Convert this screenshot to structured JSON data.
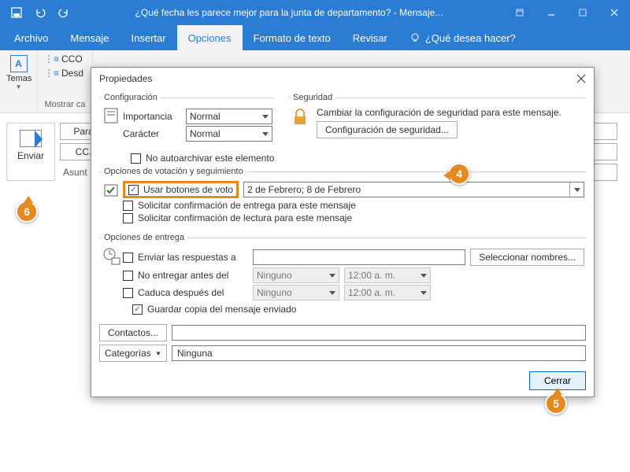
{
  "titlebar": {
    "title": "¿Qué fecha les parece mejor para la junta de departamento?  -  Mensaje..."
  },
  "menu": {
    "archivo": "Archivo",
    "mensaje": "Mensaje",
    "insertar": "Insertar",
    "opciones": "Opciones",
    "formato": "Formato de texto",
    "revisar": "Revisar",
    "tellme": "¿Qué desea hacer?"
  },
  "ribbon": {
    "temas": "Temas",
    "cco": "CCO",
    "desde": "Desd",
    "mostrar": "Mostrar ca"
  },
  "compose": {
    "enviar": "Enviar",
    "para": "Para",
    "cc": "CC.",
    "asunto": "Asunt"
  },
  "dialog": {
    "title": "Propiedades",
    "config": {
      "legend": "Configuración",
      "importancia_lbl": "Importancia",
      "caracter_lbl": "Carácter",
      "normal": "Normal",
      "noauto": "No autoarchivar este elemento"
    },
    "security": {
      "legend": "Seguridad",
      "desc": "Cambiar la configuración de seguridad para este mensaje.",
      "btn": "Configuración de seguridad..."
    },
    "voting": {
      "legend": "Opciones de votación y seguimiento",
      "use_btns": "Usar botones de voto",
      "value": "2 de Febrero; 8 de Febrero",
      "conf_entrega": "Solicitar confirmación de entrega para este mensaje",
      "conf_lectura": "Solicitar confirmación de lectura para este mensaje"
    },
    "delivery": {
      "legend": "Opciones de entrega",
      "respuestas": "Enviar las respuestas a",
      "seleccionar": "Seleccionar nombres...",
      "noentregar": "No entregar antes del",
      "caduca": "Caduca después del",
      "ninguno": "Ninguno",
      "hora": "12:00 a. m.",
      "guardar": "Guardar copia del mensaje enviado"
    },
    "contactos": "Contactos...",
    "categorias": "Categorías",
    "cat_value": "Ninguna",
    "cerrar": "Cerrar"
  },
  "callouts": {
    "c4": "4",
    "c5": "5",
    "c6": "6"
  }
}
